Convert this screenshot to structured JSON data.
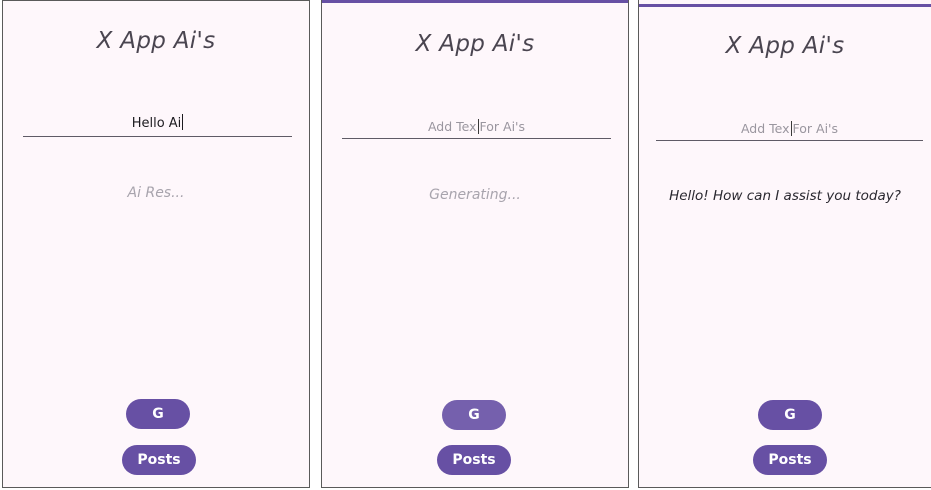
{
  "app": {
    "title": "X App Ai's"
  },
  "screens": [
    {
      "input_value": "Hello Ai",
      "input_placeholder": "",
      "response": "Ai Res...",
      "generate_label": "G",
      "posts_label": "Posts"
    },
    {
      "input_value": "",
      "input_placeholder_before": "Add Tex",
      "input_placeholder_after": "For Ai's",
      "response": "Generating...",
      "generate_label": "G",
      "posts_label": "Posts"
    },
    {
      "input_value": "",
      "input_placeholder_before": "Add Tex",
      "input_placeholder_after": "For Ai's",
      "response": "Hello! How can I assist you today?",
      "generate_label": "G",
      "posts_label": "Posts"
    }
  ],
  "colors": {
    "accent": "#6750a4",
    "background": "#fef7fb"
  }
}
